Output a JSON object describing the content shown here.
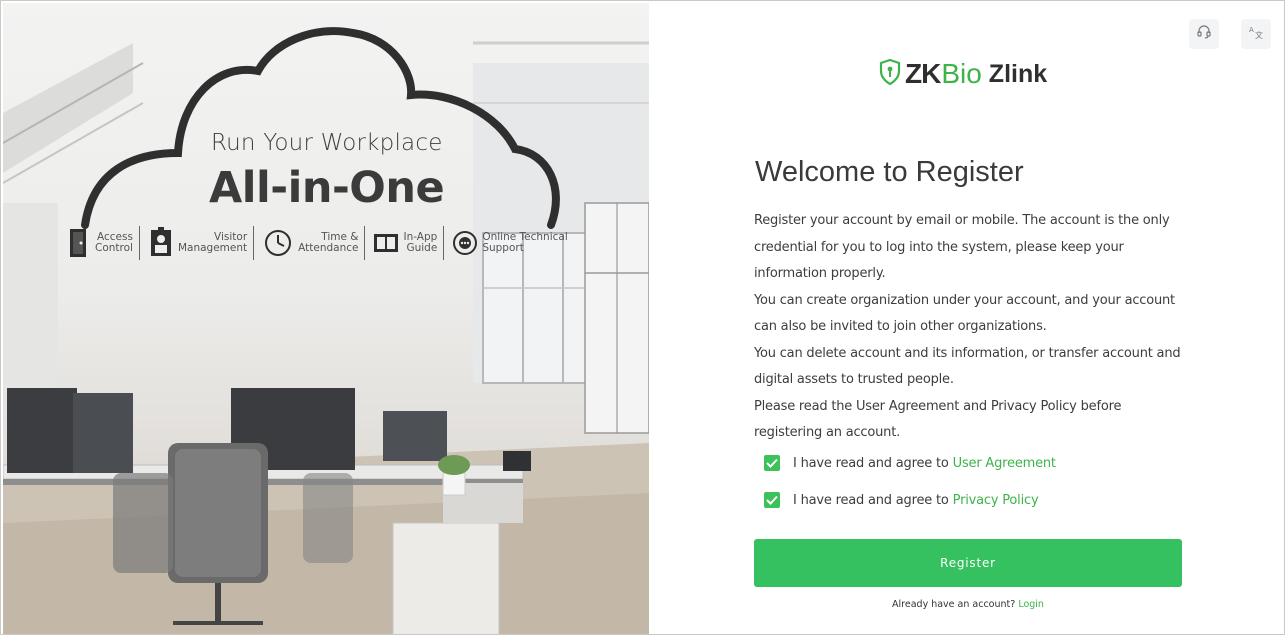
{
  "hero": {
    "headline_small": "Run Your Workplace",
    "headline_big": "All-in-One",
    "features": [
      {
        "label": "Access\nControl",
        "icon": "door-icon"
      },
      {
        "label": "Visitor\nManagement",
        "icon": "visitor-icon"
      },
      {
        "label": "Time &\nAttendance",
        "icon": "clock-icon"
      },
      {
        "label": "In-App\nGuide",
        "icon": "book-icon"
      },
      {
        "label": "Online Technical\nSupport",
        "icon": "chat-support-icon"
      }
    ]
  },
  "header": {
    "support_icon": "headset-icon",
    "language_icon": "translate-icon"
  },
  "brand": {
    "zk": "ZK",
    "bio": "Bio",
    "product": "Zlink",
    "accent_color": "#3cb44a"
  },
  "form": {
    "title": "Welcome to Register",
    "paragraphs": [
      "Register your account by email or mobile. The account is the only credential for you to log into the system, please keep your information properly.",
      "You can create organization under your account, and your account can also be invited to join other organizations.",
      "You can delete account and its information, or transfer account and digital assets to trusted people.",
      "Please read the User Agreement and Privacy Policy before registering an account."
    ],
    "agreements": [
      {
        "prefix": "I have read and agree to",
        "link": "User Agreement",
        "checked": true
      },
      {
        "prefix": "I have read and agree to",
        "link": "Privacy Policy",
        "checked": true
      }
    ],
    "register_button": "Register",
    "login_prompt": "Already have an account?",
    "login_link": "Login",
    "button_color": "#36c160"
  }
}
